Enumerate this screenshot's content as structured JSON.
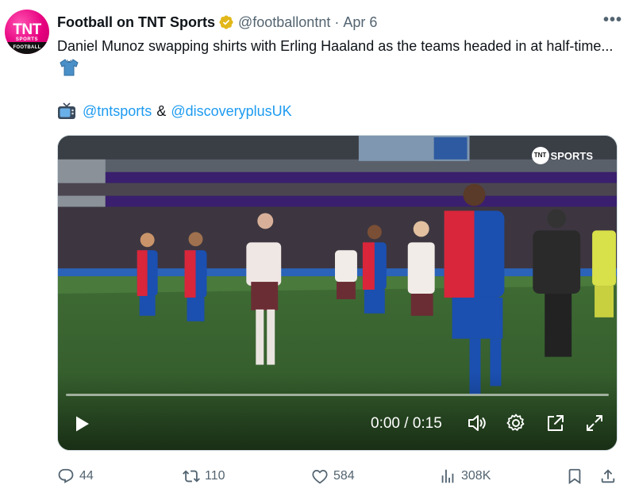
{
  "author": {
    "display_name": "Football on TNT Sports",
    "handle": "@footballontnt",
    "separator": "·",
    "date": "Apr 6",
    "avatar": {
      "logo_main": "TNT",
      "logo_sub": "SPORTS",
      "logo_band": "FOOTBALL"
    },
    "verified_icon": "gold-verified-badge-icon"
  },
  "more_icon": "more-horizontal-icon",
  "tweet": {
    "text": "Daniel Munoz swapping shirts with Erling Haaland as the teams headed in at half-time...",
    "emoji_icon": "t-shirt-icon",
    "tv_icon": "television-icon",
    "mention_1": "@tntsports",
    "ampersand": "&",
    "mention_2": "@discoveryplusUK"
  },
  "video": {
    "watermark": "SPORTS",
    "watermark_logo": "TNT",
    "progress": 0,
    "time_display": "0:00 / 0:15",
    "icons": [
      "play-icon",
      "volume-icon",
      "settings-gear-icon",
      "pop-out-icon",
      "fullscreen-icon"
    ]
  },
  "actions": {
    "replies": "44",
    "reposts": "110",
    "likes": "584",
    "views": "308K",
    "icons": [
      "reply-icon",
      "repost-icon",
      "like-icon",
      "views-icon",
      "bookmark-icon",
      "share-icon"
    ]
  },
  "colors": {
    "link": "#1d9bf0",
    "secondary_text": "#536471",
    "brand_pink": "#e6007e",
    "verified_gold": "#e2b719"
  }
}
